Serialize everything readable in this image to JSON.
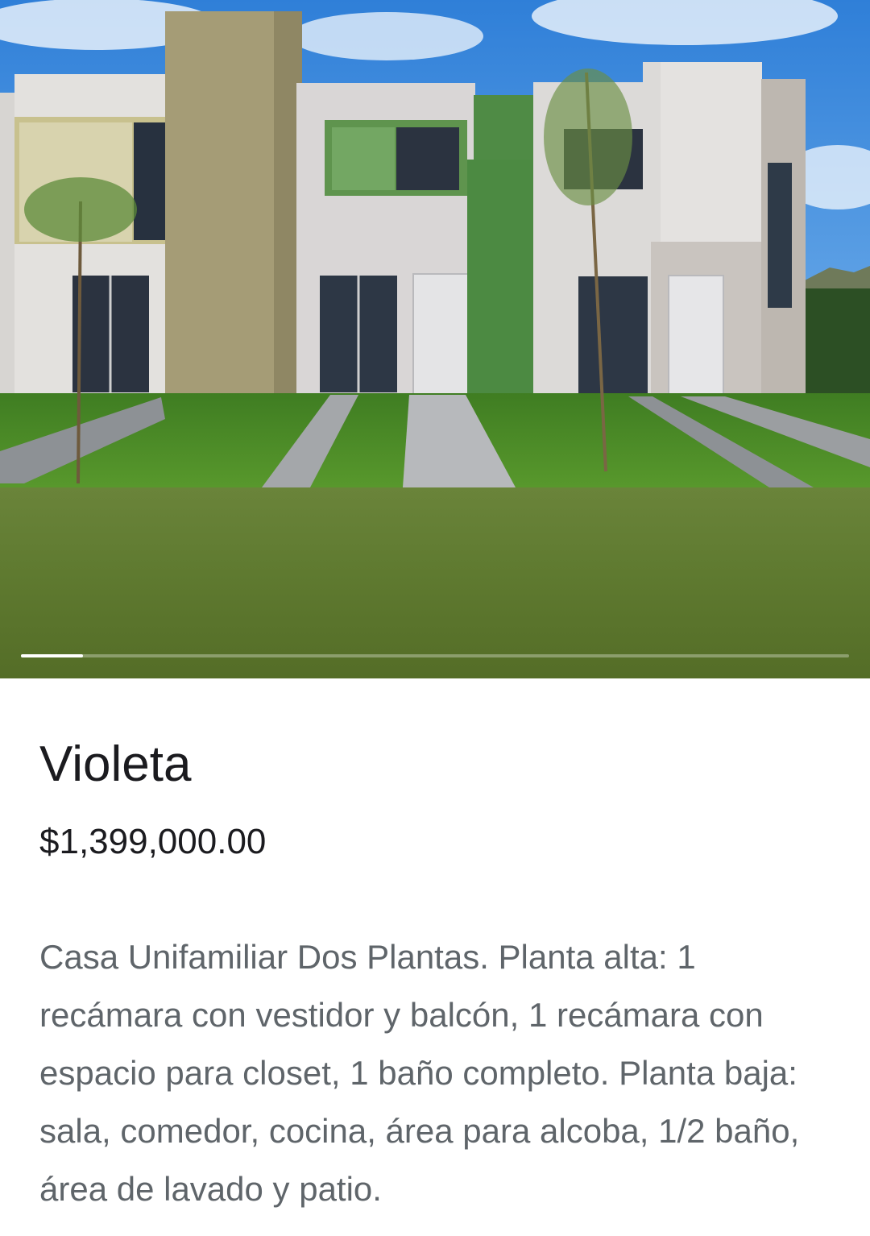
{
  "carousel": {
    "image_icon": "house-photo",
    "progress_fraction": 0.075,
    "colors": {
      "band": "#5f7a30",
      "track": "#9fb07c",
      "indicator": "#ffffff"
    }
  },
  "listing": {
    "title": "Violeta",
    "price": "$1,399,000.00",
    "description": "Casa Unifamiliar Dos Plantas. Planta alta: 1 recámara con vestidor y balcón, 1 recámara con espacio para closet, 1 baño completo. Planta baja: sala, comedor, cocina, área para alcoba, 1/2 baño, área de lavado y patio."
  }
}
